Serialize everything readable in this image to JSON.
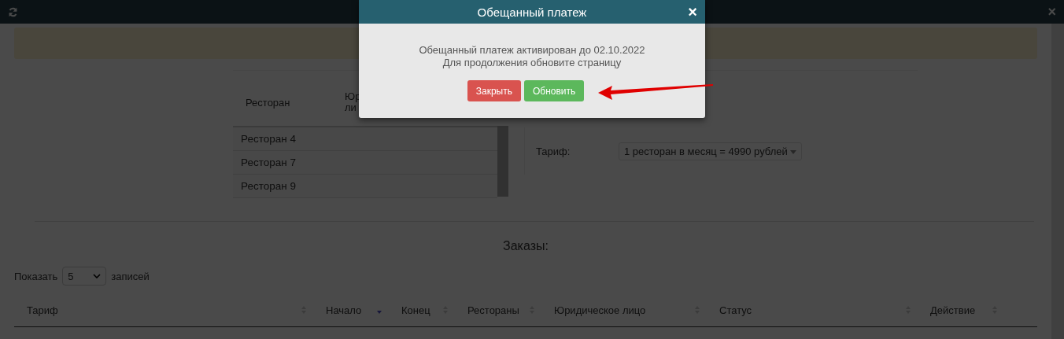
{
  "window_close": "×",
  "restaurants_table": {
    "columns": [
      "Ресторан",
      "Юр ли"
    ],
    "rows": [
      "Ресторан 4",
      "Ресторан 7",
      "Ресторан 9"
    ]
  },
  "tariff": {
    "label": "Тариф:",
    "value": "1 ресторан в месяц = 4990 рублей"
  },
  "orders": {
    "title": "Заказы:",
    "show_label": "Показать",
    "page_size": "5",
    "entries_label": "записей",
    "columns": [
      {
        "label": "Тариф",
        "sorted": false
      },
      {
        "label": "Начало",
        "sorted": true
      },
      {
        "label": "Конец",
        "sorted": false
      },
      {
        "label": "Рестораны",
        "sorted": false
      },
      {
        "label": "Юридическое лицо",
        "sorted": false
      },
      {
        "label": "Статус",
        "sorted": false
      },
      {
        "label": "Действие",
        "sorted": false
      }
    ]
  },
  "dialog": {
    "title": "Обещанный платеж",
    "close_symbol": "×",
    "message": [
      "Обещанный платеж активирован до 02.10.2022",
      "Для продолжения обновите страницу"
    ],
    "buttons": [
      {
        "label": "Закрыть",
        "kind": "danger"
      },
      {
        "label": "Обновить",
        "kind": "success"
      }
    ]
  }
}
